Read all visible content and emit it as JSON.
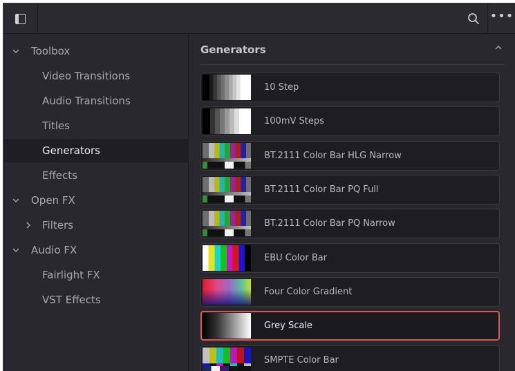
{
  "toolbar": {
    "panel_toggle_icon": "sidebar-panel-icon",
    "search_icon": "search-icon",
    "more_icon": "more-options-icon",
    "more_glyph": "•••"
  },
  "sidebar": {
    "items": [
      {
        "label": "Toolbox",
        "expander": "expanded"
      },
      {
        "label": "Video Transitions"
      },
      {
        "label": "Audio Transitions"
      },
      {
        "label": "Titles"
      },
      {
        "label": "Generators",
        "selected": true
      },
      {
        "label": "Effects"
      },
      {
        "label": "Open FX",
        "expander": "expanded"
      },
      {
        "label": "Filters",
        "expander": "collapsed"
      },
      {
        "label": "Audio FX",
        "expander": "expanded"
      },
      {
        "label": "Fairlight FX"
      },
      {
        "label": "VST Effects"
      }
    ]
  },
  "generators": {
    "title": "Generators",
    "collapse_icon": "chevron-up-icon",
    "items": [
      {
        "label": "10 Step"
      },
      {
        "label": "100mV Steps"
      },
      {
        "label": "BT.2111 Color Bar HLG Narrow"
      },
      {
        "label": "BT.2111 Color Bar PQ Full"
      },
      {
        "label": "BT.2111 Color Bar PQ Narrow"
      },
      {
        "label": "EBU Color Bar"
      },
      {
        "label": "Four Color Gradient"
      },
      {
        "label": "Grey Scale",
        "selected": true
      },
      {
        "label": "SMPTE Color Bar"
      }
    ]
  },
  "colors": {
    "background": "#28282e",
    "selection_border": "#e0584b",
    "text": "#a9a9ae"
  }
}
